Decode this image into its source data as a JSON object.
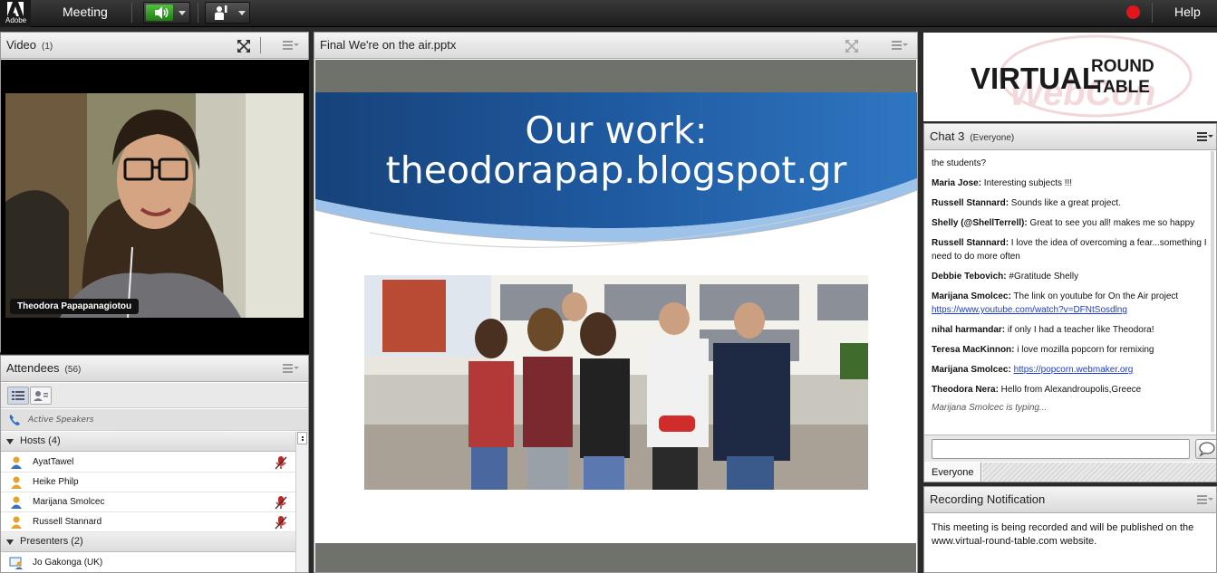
{
  "topbar": {
    "adobe_label": "Adobe",
    "meeting_menu": "Meeting",
    "help_menu": "Help",
    "recording_color": "#e2141c",
    "audio_color": "#3aa82a"
  },
  "video_pod": {
    "title": "Video",
    "count": "(1)",
    "participant_name": "Theodora Papapanagiotou"
  },
  "attendees_pod": {
    "title": "Attendees",
    "count": "(56)",
    "active_speakers_label": "Active Speakers",
    "hosts_header": "Hosts (4)",
    "hosts": [
      {
        "name": "AyatTawel",
        "mic": true
      },
      {
        "name": "Heike  Philp",
        "mic": false
      },
      {
        "name": "Marijana Smolcec",
        "mic": true
      },
      {
        "name": "Russell Stannard",
        "mic": true
      }
    ],
    "presenters_header": "Presenters (2)",
    "presenters": [
      {
        "name": "Jo Gakonga (UK)"
      }
    ]
  },
  "share_pod": {
    "title": "Final We're on the air.pptx",
    "slide_title_line1": "Our work:",
    "slide_title_line2": "theodorapap.blogspot.gr"
  },
  "logo": {
    "line1": "VIRTUAL",
    "line2a": "ROUND",
    "line2b": "TABLE",
    "watermark": "WebCon"
  },
  "chat_pod": {
    "title": "Chat 3",
    "audience": "(Everyone)",
    "messages": [
      {
        "sender": "",
        "text": "the students?"
      },
      {
        "sender": "Maria Jose:",
        "text": " Interesting subjects !!!"
      },
      {
        "sender": "Russell Stannard:",
        "text": " Sounds like a great project."
      },
      {
        "sender": "Shelly (@ShellTerrell):",
        "text": " Great to see you all! makes me so happy"
      },
      {
        "sender": "Russell Stannard:",
        "text": " I love the idea of overcoming a fear...something I need to do more often"
      },
      {
        "sender": "Debbie Tebovich:",
        "text": " #Gratitude Shelly"
      },
      {
        "sender": "Marijana Smolcec:",
        "text": " The link on youtube for On the Air project ",
        "link": "https://www.youtube.com/watch?v=DFNtSosdlng"
      },
      {
        "sender": "nihal harmandar:",
        "text": " if only I had a teacher like Theodora!"
      },
      {
        "sender": "Teresa MacKinnon:",
        "text": " i love mozilla popcorn for remixing"
      },
      {
        "sender": "Marijana Smolcec:",
        "text": " ",
        "link": "https://popcorn.webmaker.org"
      },
      {
        "sender": "Theodora Nera:",
        "text": " Hello from Alexandroupolis,Greece"
      }
    ],
    "typing": "Marijana Smolcec is typing...",
    "input_value": "",
    "tab_everyone": "Everyone"
  },
  "recording_pod": {
    "title": "Recording Notification",
    "body": "This meeting is being recorded and will be published on the www.virtual-round-table.com website."
  }
}
